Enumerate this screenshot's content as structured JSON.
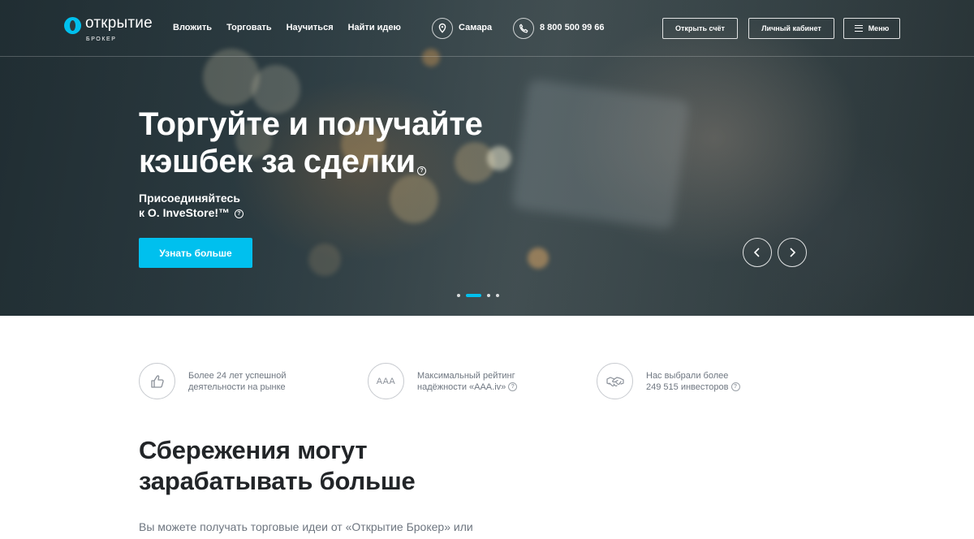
{
  "header": {
    "logo_text": "открытие",
    "logo_sub": "БРОКЕР",
    "nav": [
      {
        "label": "Вложить"
      },
      {
        "label": "Торговать"
      },
      {
        "label": "Научиться"
      },
      {
        "label": "Найти идею"
      }
    ],
    "city": "Самара",
    "phone": "8 800 500 99 66",
    "open_account": "Открыть счёт",
    "personal_cabinet": "Личный кабинет",
    "menu": "Меню"
  },
  "hero": {
    "title_line1": "Торгуйте и получайте",
    "title_line2": "кэшбек за сделки",
    "subtitle_line1": "Присоединяйтесь",
    "subtitle_line2": "к О. InveStore!™",
    "cta": "Узнать больше",
    "slide_count": 4,
    "active_slide": 2
  },
  "features": [
    {
      "icon": "thumbs-up-icon",
      "line1": "Более 24 лет успешной",
      "line2": "деятельности на рынке"
    },
    {
      "icon": "aaa-rating-icon",
      "icon_text": "AAA",
      "line1": "Максимальный рейтинг",
      "line2": "надёжности «AAA.iv»"
    },
    {
      "icon": "handshake-icon",
      "line1": "Нас выбрали более",
      "line2": "249 515 инвесторов"
    }
  ],
  "section": {
    "title_line1": "Сбережения могут",
    "title_line2": "зарабатывать больше",
    "text": "Вы можете получать торговые идеи от «Открытие Брокер» или"
  },
  "colors": {
    "accent": "#00c0ee",
    "text_dark": "#222528",
    "text_muted": "#6e7680"
  }
}
